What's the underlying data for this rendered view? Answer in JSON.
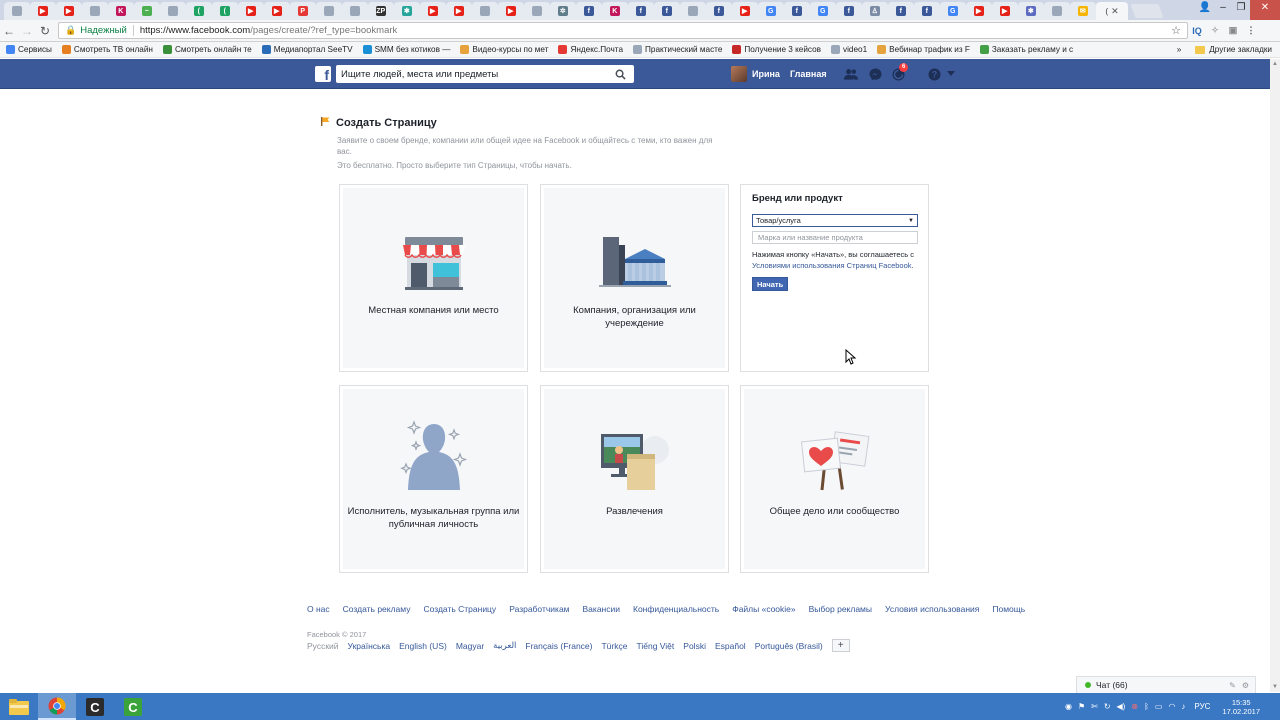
{
  "browser": {
    "tabs": [
      {
        "icon": "doc-icon",
        "color": "#9aa7b8",
        "glyph": ""
      },
      {
        "icon": "youtube-icon",
        "color": "#e62117",
        "glyph": "▶"
      },
      {
        "icon": "youtube-icon",
        "color": "#e62117",
        "glyph": "▶"
      },
      {
        "icon": "doc-icon",
        "color": "#9aa7b8",
        "glyph": ""
      },
      {
        "icon": "k-icon",
        "color": "#c2185b",
        "glyph": "K"
      },
      {
        "icon": "chart-icon",
        "color": "#4caf50",
        "glyph": "~"
      },
      {
        "icon": "doc-icon",
        "color": "#9aa7b8",
        "glyph": ""
      },
      {
        "icon": "green-circle-icon",
        "color": "#1ea362",
        "glyph": "("
      },
      {
        "icon": "green-circle-icon",
        "color": "#1ea362",
        "glyph": "("
      },
      {
        "icon": "youtube-icon",
        "color": "#e62117",
        "glyph": "▶"
      },
      {
        "icon": "youtube-icon",
        "color": "#e62117",
        "glyph": "▶"
      },
      {
        "icon": "pdf-icon",
        "color": "#e53935",
        "glyph": "P"
      },
      {
        "icon": "doc-icon",
        "color": "#9aa7b8",
        "glyph": ""
      },
      {
        "icon": "doc-icon",
        "color": "#9aa7b8",
        "glyph": ""
      },
      {
        "icon": "zp-icon",
        "color": "#333333",
        "glyph": "ZP"
      },
      {
        "icon": "puzzle-icon",
        "color": "#26a69a",
        "glyph": "✱"
      },
      {
        "icon": "youtube-icon",
        "color": "#e62117",
        "glyph": "▶"
      },
      {
        "icon": "youtube-icon",
        "color": "#e62117",
        "glyph": "▶"
      },
      {
        "icon": "doc-icon",
        "color": "#9aa7b8",
        "glyph": ""
      },
      {
        "icon": "youtube-icon",
        "color": "#e62117",
        "glyph": "▶"
      },
      {
        "icon": "doc-icon",
        "color": "#9aa7b8",
        "glyph": ""
      },
      {
        "icon": "gear-icon",
        "color": "#607d8b",
        "glyph": "✲"
      },
      {
        "icon": "facebook-icon",
        "color": "#3b5998",
        "glyph": "f"
      },
      {
        "icon": "k-icon",
        "color": "#c2185b",
        "glyph": "K"
      },
      {
        "icon": "facebook-icon",
        "color": "#3b5998",
        "glyph": "f"
      },
      {
        "icon": "facebook-icon",
        "color": "#3b5998",
        "glyph": "f"
      },
      {
        "icon": "doc-icon",
        "color": "#9aa7b8",
        "glyph": ""
      },
      {
        "icon": "facebook-icon",
        "color": "#3b5998",
        "glyph": "f"
      },
      {
        "icon": "youtube-icon",
        "color": "#e62117",
        "glyph": "▶"
      },
      {
        "icon": "google-icon",
        "color": "#4285f4",
        "glyph": "G"
      },
      {
        "icon": "facebook-icon",
        "color": "#3b5998",
        "glyph": "f"
      },
      {
        "icon": "google-icon",
        "color": "#4285f4",
        "glyph": "G"
      },
      {
        "icon": "facebook-icon",
        "color": "#3b5998",
        "glyph": "f"
      },
      {
        "icon": "person-icon",
        "color": "#7a8ba3",
        "glyph": "♙"
      },
      {
        "icon": "facebook-icon",
        "color": "#3b5998",
        "glyph": "f"
      },
      {
        "icon": "facebook-icon",
        "color": "#3b5998",
        "glyph": "f"
      },
      {
        "icon": "google-icon",
        "color": "#4285f4",
        "glyph": "G"
      },
      {
        "icon": "youtube-icon",
        "color": "#e62117",
        "glyph": "▶"
      },
      {
        "icon": "youtube-icon",
        "color": "#e62117",
        "glyph": "▶"
      },
      {
        "icon": "puzzle-icon",
        "color": "#5c6bc0",
        "glyph": "✱"
      },
      {
        "icon": "doc-icon",
        "color": "#9aa7b8",
        "glyph": ""
      },
      {
        "icon": "mail-icon",
        "color": "#f4b400",
        "glyph": "✉"
      }
    ],
    "active_tab_label": "(",
    "address": {
      "secure_label": "Надежный",
      "url_host": "https://www.facebook.com",
      "url_path": "/pages/create/?ref_type=bookmark"
    },
    "bookmarks": [
      {
        "label": "Сервисы",
        "icon": "apps-icon",
        "color": "#4285f4"
      },
      {
        "label": "Смотреть ТВ онлайн",
        "icon": "tv-icon",
        "color": "#e67e22"
      },
      {
        "label": "Смотреть онлайн те",
        "icon": "tv-icon",
        "color": "#3a8f3a"
      },
      {
        "label": "Медиапортал SeeTV",
        "icon": "s-icon",
        "color": "#2a6cb8"
      },
      {
        "label": "SMM без котиков —",
        "icon": "smm-icon",
        "color": "#1a8fd6"
      },
      {
        "label": "Видео-курсы по мет",
        "icon": "check-icon",
        "color": "#e6a23c"
      },
      {
        "label": "Яндекс.Почта",
        "icon": "mail-icon",
        "color": "#e53935"
      },
      {
        "label": "Практический масте",
        "icon": "doc-icon",
        "color": "#9aa7b8"
      },
      {
        "label": "Получение 3 кейсов",
        "icon": "x-icon",
        "color": "#c62828"
      },
      {
        "label": "video1",
        "icon": "doc-icon",
        "color": "#9aa7b8"
      },
      {
        "label": "Вебинар трафик из F",
        "icon": "check-icon",
        "color": "#e6a23c"
      },
      {
        "label": "Заказать рекламу и с",
        "icon": "g-icon",
        "color": "#43a047"
      }
    ],
    "bookmarks_more": "»",
    "other_bookmarks": "Другие закладки"
  },
  "fb_header": {
    "search_placeholder": "Ищите людей, места или предметы",
    "user_name": "Ирина",
    "home_label": "Главная",
    "notifications_count": "6"
  },
  "page": {
    "title": "Создать Страницу",
    "description": "Заявите о своем бренде, компании или общей идее на Facebook и общайтесь с теми, кто важен для вас.",
    "free_note": "Это бесплатно. Просто выберите тип Страницы, чтобы начать.",
    "categories": [
      {
        "label": "Местная компания или место"
      },
      {
        "label": "Компания, организация или учереждение"
      },
      {
        "label": "Исполнитель, музыкальная группа или публичная личность"
      },
      {
        "label": "Развлечения"
      },
      {
        "label": "Общее дело или сообщество"
      }
    ],
    "brand_card": {
      "title": "Бренд или продукт",
      "select_value": "Товар/услуга",
      "name_placeholder": "Марка или название продукта",
      "terms_prefix": "Нажимая кнопку «Начать», вы соглашаетесь с ",
      "terms_link": "Условиями использования Страниц Facebook",
      "terms_suffix": ".",
      "start_label": "Начать"
    }
  },
  "footer": {
    "links": [
      "О нас",
      "Создать рекламу",
      "Создать Страницу",
      "Разработчикам",
      "Вакансии",
      "Конфиденциальность",
      "Файлы «cookie»",
      "Выбор рекламы",
      "Условия использования",
      "Помощь"
    ],
    "copyright": "Facebook © 2017",
    "current_language": "Русский",
    "languages": [
      "Українська",
      "English (US)",
      "Magyar",
      "العربية",
      "Français (France)",
      "Türkçe",
      "Tiếng Việt",
      "Polski",
      "Español",
      "Português (Brasil)"
    ],
    "more_languages": "+"
  },
  "chat": {
    "label": "Чат (66)"
  },
  "taskbar": {
    "lang": "РУС",
    "time": "15:35",
    "date": "17.02.2017"
  }
}
